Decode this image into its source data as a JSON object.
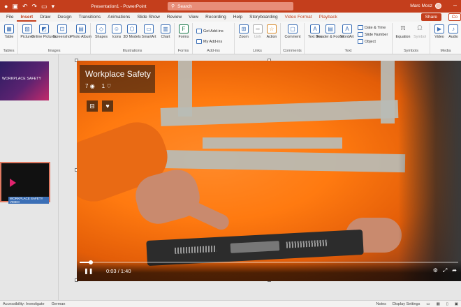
{
  "titlebar": {
    "quick_access": [
      "autosave",
      "save",
      "undo",
      "redo",
      "start-from-beginning"
    ],
    "doc_title": "Presentation1 - PowerPoint",
    "search_placeholder": "Search",
    "user_name": "Marc Mosz"
  },
  "tabs": {
    "items": [
      "File",
      "Insert",
      "Draw",
      "Design",
      "Transitions",
      "Animations",
      "Slide Show",
      "Review",
      "View",
      "Recording",
      "Help",
      "Storyboarding",
      "Video Format",
      "Playback"
    ],
    "active": "Insert",
    "share_label": "Share",
    "comments_label": "Co"
  },
  "ribbon": {
    "groups": [
      {
        "label": "Tables",
        "buttons": [
          "Table"
        ]
      },
      {
        "label": "Images",
        "buttons": [
          "Pictures",
          "Online Pictures",
          "Screenshot",
          "Photo Album"
        ]
      },
      {
        "label": "Illustrations",
        "buttons": [
          "Shapes",
          "Icons",
          "3D Models",
          "SmartArt",
          "Chart"
        ]
      },
      {
        "label": "Forms",
        "buttons": [
          "Forms"
        ]
      },
      {
        "label": "Add-ins",
        "buttons": [
          "Get Add-ins",
          "My Add-ins"
        ]
      },
      {
        "label": "Links",
        "buttons": [
          "Zoom",
          "Link",
          "Action"
        ]
      },
      {
        "label": "Comments",
        "buttons": [
          "Comment"
        ]
      },
      {
        "label": "Text",
        "buttons": [
          "Text Box",
          "Header & Footer",
          "WordArt",
          "Date & Time",
          "Slide Number",
          "Object"
        ]
      },
      {
        "label": "Symbols",
        "buttons": [
          "Equation",
          "Symbol"
        ]
      },
      {
        "label": "Media",
        "buttons": [
          "Video",
          "Audio"
        ]
      }
    ]
  },
  "slides": {
    "thumb1_num": "1",
    "thumb1_text": "WORKPLACE SAFETY",
    "thumb2_num": "2",
    "thumb2_caption": "WORKPLACE SAFETY VIDEO"
  },
  "video": {
    "title": "Workplace Safety",
    "views": "7",
    "likes": "1",
    "current_time": "0:03",
    "separator": "/",
    "duration": "1:40",
    "progress": 0.03
  },
  "status": {
    "accessibility": "Accessibility: Investigate",
    "language": "German",
    "notes": "Notes",
    "display_settings": "Display Settings"
  }
}
